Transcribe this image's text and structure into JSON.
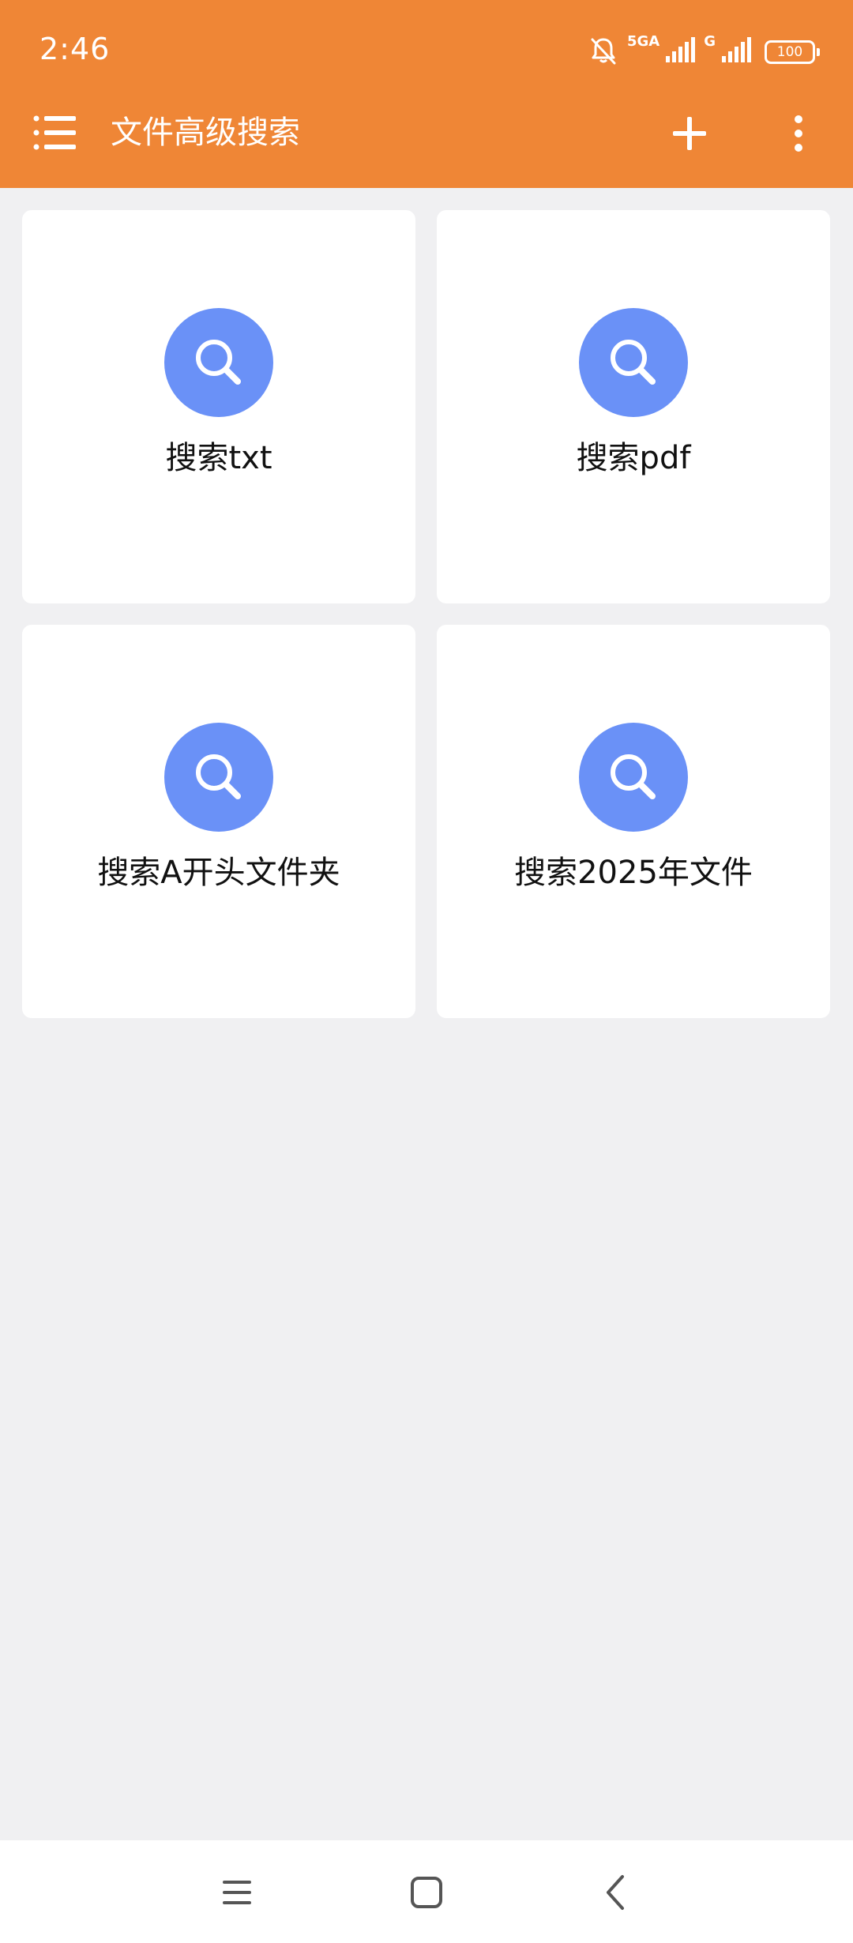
{
  "status_bar": {
    "time": "2:46",
    "network_primary": "5GA",
    "network_secondary": "G",
    "battery": "100"
  },
  "app_bar": {
    "title": "文件高级搜索",
    "menu_icon": "list-menu-icon",
    "add_icon": "plus-icon",
    "more_icon": "more-vertical-icon"
  },
  "cards": [
    {
      "label": "搜索txt",
      "icon": "search-icon"
    },
    {
      "label": "搜索pdf",
      "icon": "search-icon"
    },
    {
      "label": "搜索A开头文件夹",
      "icon": "search-icon"
    },
    {
      "label": "搜索2025年文件",
      "icon": "search-icon"
    }
  ],
  "nav_bar": {
    "recents_icon": "recents-icon",
    "home_icon": "home-icon",
    "back_icon": "back-icon"
  },
  "colors": {
    "app_bar": "#ef8636",
    "background": "#f0f0f2",
    "card": "#ffffff",
    "icon_circle": "#6a91f7",
    "text": "#111111"
  }
}
